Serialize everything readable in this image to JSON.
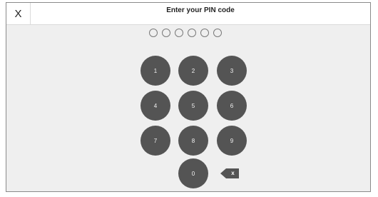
{
  "header": {
    "close_label": "X",
    "title": "Enter your PIN code"
  },
  "pin": {
    "length": 6,
    "entered": 0
  },
  "keypad": {
    "keys": [
      "1",
      "2",
      "3",
      "4",
      "5",
      "6",
      "7",
      "8",
      "9",
      "0"
    ],
    "backspace_label": "x"
  },
  "colors": {
    "key_fill": "#545454",
    "background": "#efefef",
    "header": "#ffffff"
  }
}
